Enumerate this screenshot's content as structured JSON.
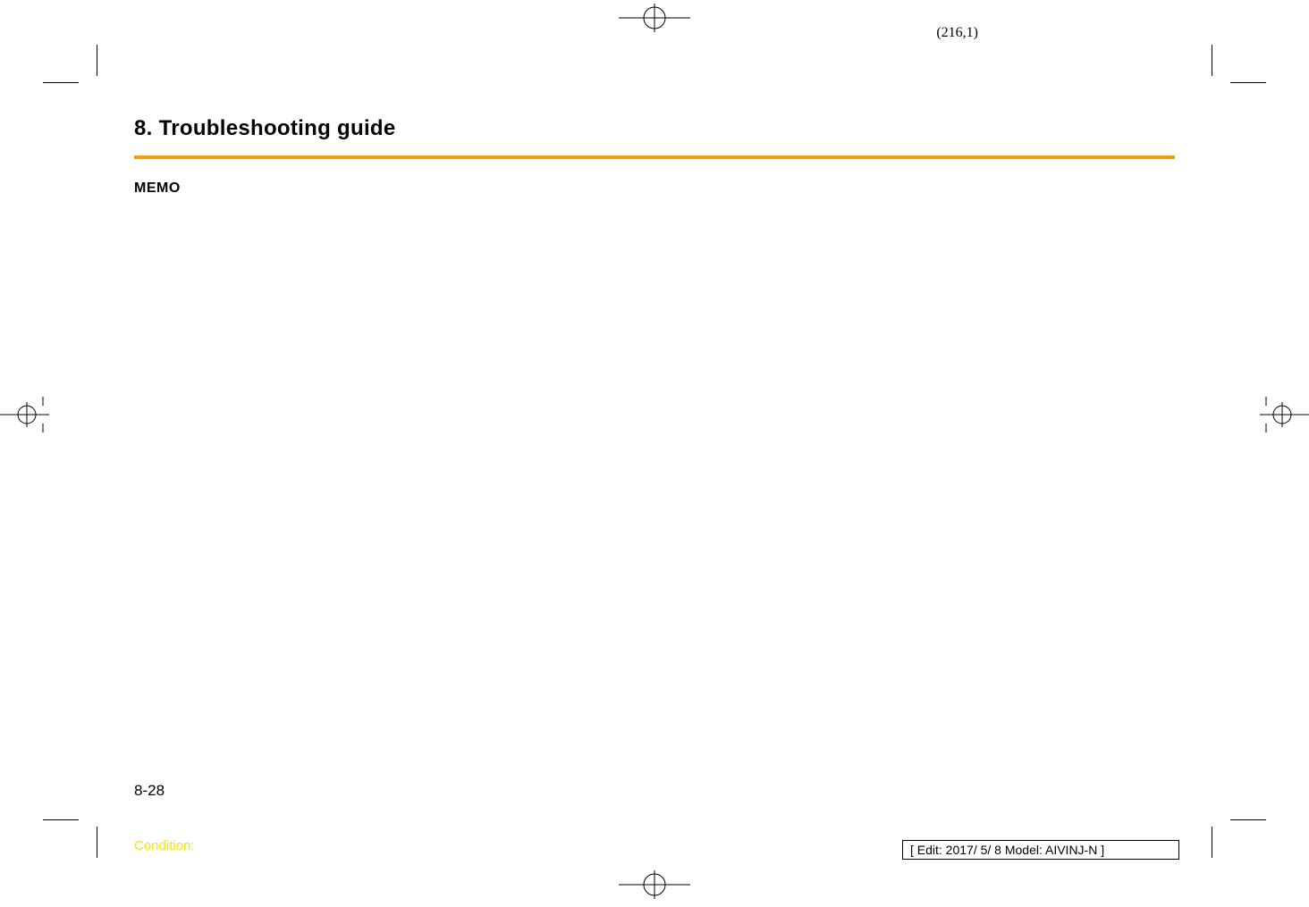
{
  "meta": {
    "page_coords": "(216,1)"
  },
  "header": {
    "chapter_title": "8. Troubleshooting guide"
  },
  "body": {
    "memo_heading": "MEMO"
  },
  "footer": {
    "page_number": "8-28",
    "condition_label": "Condition:",
    "edit_info": "[ Edit: 2017/ 5/ 8   Model:  AIVINJ-N ]"
  }
}
